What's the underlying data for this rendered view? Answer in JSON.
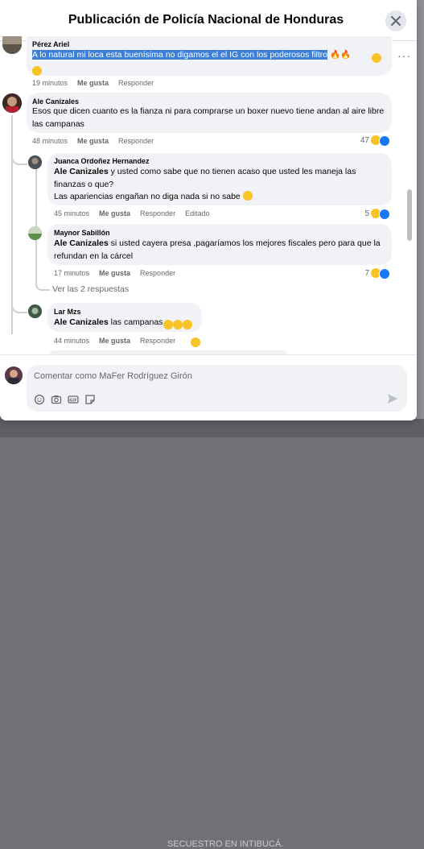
{
  "dialog": {
    "title": "Publicación de Policía Nacional de Honduras"
  },
  "background": {
    "bottom_text": "SECUESTRO EN INTIBUCÁ."
  },
  "comments": [
    {
      "author": "Pérez Ariel",
      "text": "A lo natural mi loca esta buenísima no digamos el el IG con los poderosos filtro",
      "time": "19 minutos",
      "like": "Me gusta",
      "reply": "Responder"
    },
    {
      "author": "Ale Canizales",
      "text": "Esos que dicen cuanto es la fianza ni para comprarse un boxer nuevo tiene andan al aire libre las campanas",
      "time": "48 minutos",
      "like": "Me gusta",
      "reply": "Responder",
      "reactions": "47"
    }
  ],
  "replies": [
    {
      "author": "Juanca Ordoñez Hernandez",
      "mention": "Ale Canizales",
      "text": "y usted como sabe que no tienen acaso que usted les maneja las finanzas o que?",
      "text2": "Las apariencias engañan no diga nada si no sabe",
      "time": "45 minutos",
      "like": "Me gusta",
      "reply": "Responder",
      "edited": "Editado",
      "reactions": "5"
    },
    {
      "author": "Maynor Sabillón",
      "mention": "Ale Canizales",
      "text": "si usted cayera presa ,pagaríamos los mejores fiscales pero para que la refundan en la cárcel",
      "time": "17 minutos",
      "like": "Me gusta",
      "reply": "Responder",
      "reactions": "7"
    },
    {
      "author": "Lar Mzs",
      "mention": "Ale Canizales",
      "text": "las campanas",
      "time": "44 minutos",
      "like": "Me gusta",
      "reply": "Responder"
    }
  ],
  "thread": {
    "more_replies": "Ver las 2 respuestas"
  },
  "composer": {
    "placeholder": "Comentar como MaFer Rodríguez Girón"
  },
  "icons": [
    "close-icon",
    "more-icon",
    "laugh-reaction-icon",
    "like-reaction-icon",
    "sticker-smile-icon",
    "camera-icon",
    "gif-icon",
    "sticker-icon",
    "send-icon",
    "fire-emoji-icon"
  ],
  "colors": {
    "accent": "#1877f2",
    "bubble": "#f0f2f5",
    "selection": "#3d7fd6"
  }
}
